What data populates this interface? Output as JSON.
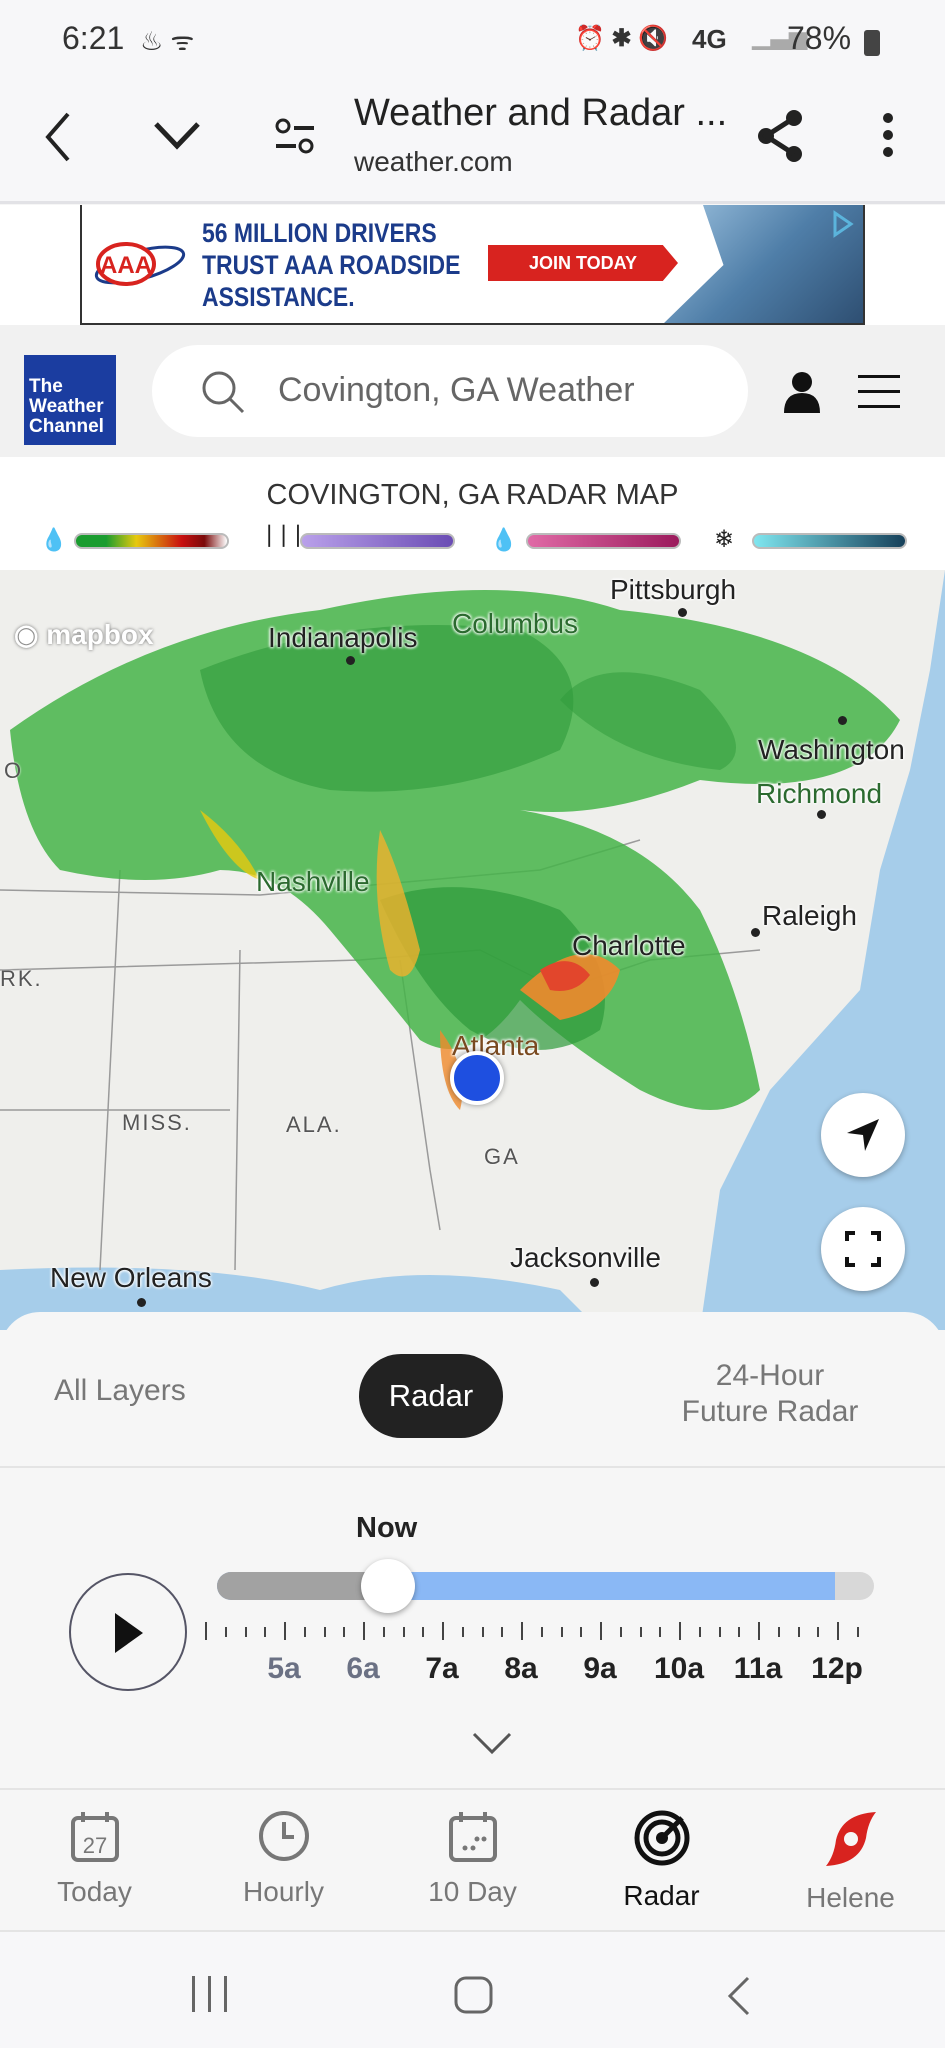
{
  "status": {
    "time": "6:21",
    "network": "4G",
    "battery": "78%"
  },
  "browser": {
    "title": "Weather and Radar ...",
    "url": "weather.com"
  },
  "ad": {
    "line1": "56 MILLION DRIVERS",
    "line2": "TRUST AAA ROADSIDE",
    "line3": "ASSISTANCE.",
    "cta": "JOIN TODAY",
    "logo": "AAA"
  },
  "header": {
    "logo_lines": [
      "The",
      "Weather",
      "Channel"
    ],
    "search_value": "Covington, GA Weather"
  },
  "legend": {
    "title": "COVINGTON, GA RADAR MAP",
    "items": [
      {
        "icon": "rain-drop-icon",
        "colors": [
          "#1a9c2f",
          "#e7c90e",
          "#c80f0f",
          "#ffffff"
        ]
      },
      {
        "icon": "ice-icon",
        "colors": [
          "#b9a0ea",
          "#6a4cb4"
        ]
      },
      {
        "icon": "mixed-icon",
        "colors": [
          "#e06aa6",
          "#9b1a5c"
        ]
      },
      {
        "icon": "snow-icon",
        "colors": [
          "#7fe6ef",
          "#16405a"
        ]
      }
    ]
  },
  "map": {
    "attribution": "mapbox",
    "cities": [
      "Pittsburgh",
      "Indianapolis",
      "Columbus",
      "Washington",
      "Richmond",
      "Nashville",
      "Raleigh",
      "Charlotte",
      "Atlanta",
      "Jacksonville",
      "New Orleans"
    ],
    "states": [
      "MISS.",
      "ALA.",
      "GA",
      "RK.",
      "O"
    ]
  },
  "tabs": {
    "items": [
      "All Layers",
      "Radar",
      "24-Hour Future Radar"
    ],
    "active": "Radar",
    "future_line1": "24-Hour",
    "future_line2": "Future Radar"
  },
  "timeline": {
    "current_label": "Now",
    "position_fraction": 0.26,
    "loaded_fraction": 0.94,
    "times": [
      "5a",
      "6a",
      "7a",
      "8a",
      "9a",
      "10a",
      "11a",
      "12p"
    ],
    "past_times": [
      "5a",
      "6a"
    ]
  },
  "bottom_nav": {
    "items": [
      {
        "label": "Today",
        "icon": "calendar-icon",
        "badge": "27"
      },
      {
        "label": "Hourly",
        "icon": "clock-icon"
      },
      {
        "label": "10 Day",
        "icon": "calendar-dots-icon"
      },
      {
        "label": "Radar",
        "icon": "radar-icon"
      },
      {
        "label": "Helene",
        "icon": "hurricane-icon",
        "color": "#d8231f"
      }
    ],
    "active": "Radar"
  }
}
